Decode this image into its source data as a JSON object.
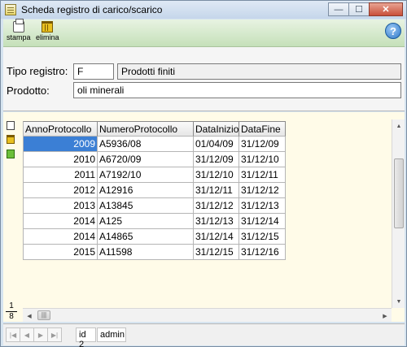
{
  "window": {
    "title": "Scheda registro di carico/scarico",
    "minimize": "—",
    "maximize": "☐",
    "close": "✕"
  },
  "toolbar": {
    "print_label": "stampa",
    "delete_label": "elimina",
    "help_label": "?"
  },
  "form": {
    "tipo_label": "Tipo registro:",
    "tipo_code": "F",
    "tipo_desc": "Prodotti finiti",
    "prodotto_label": "Prodotto:",
    "prodotto_value": "oli minerali"
  },
  "grid": {
    "columns": [
      "AnnoProtocollo",
      "NumeroProtocollo",
      "DataInizio",
      "DataFine"
    ],
    "rows": [
      [
        "2009",
        "A5936/08",
        "01/04/09",
        "31/12/09"
      ],
      [
        "2010",
        "A6720/09",
        "31/12/09",
        "31/12/10"
      ],
      [
        "2011",
        "A7192/10",
        "31/12/10",
        "31/12/11"
      ],
      [
        "2012",
        "A12916",
        "31/12/11",
        "31/12/12"
      ],
      [
        "2013",
        "A13845",
        "31/12/12",
        "31/12/13"
      ],
      [
        "2014",
        "A125",
        "31/12/13",
        "31/12/14"
      ],
      [
        "2014",
        "A14865",
        "31/12/14",
        "31/12/15"
      ],
      [
        "2015",
        "A11598",
        "31/12/15",
        "31/12/16"
      ]
    ],
    "page_current": "1",
    "page_total": "8",
    "hscroll_grip": "|||"
  },
  "status": {
    "id": "id 2",
    "user": "admin",
    "nav_first": "|◀",
    "nav_prev": "◀",
    "nav_next": "▶",
    "nav_last": "▶|"
  }
}
